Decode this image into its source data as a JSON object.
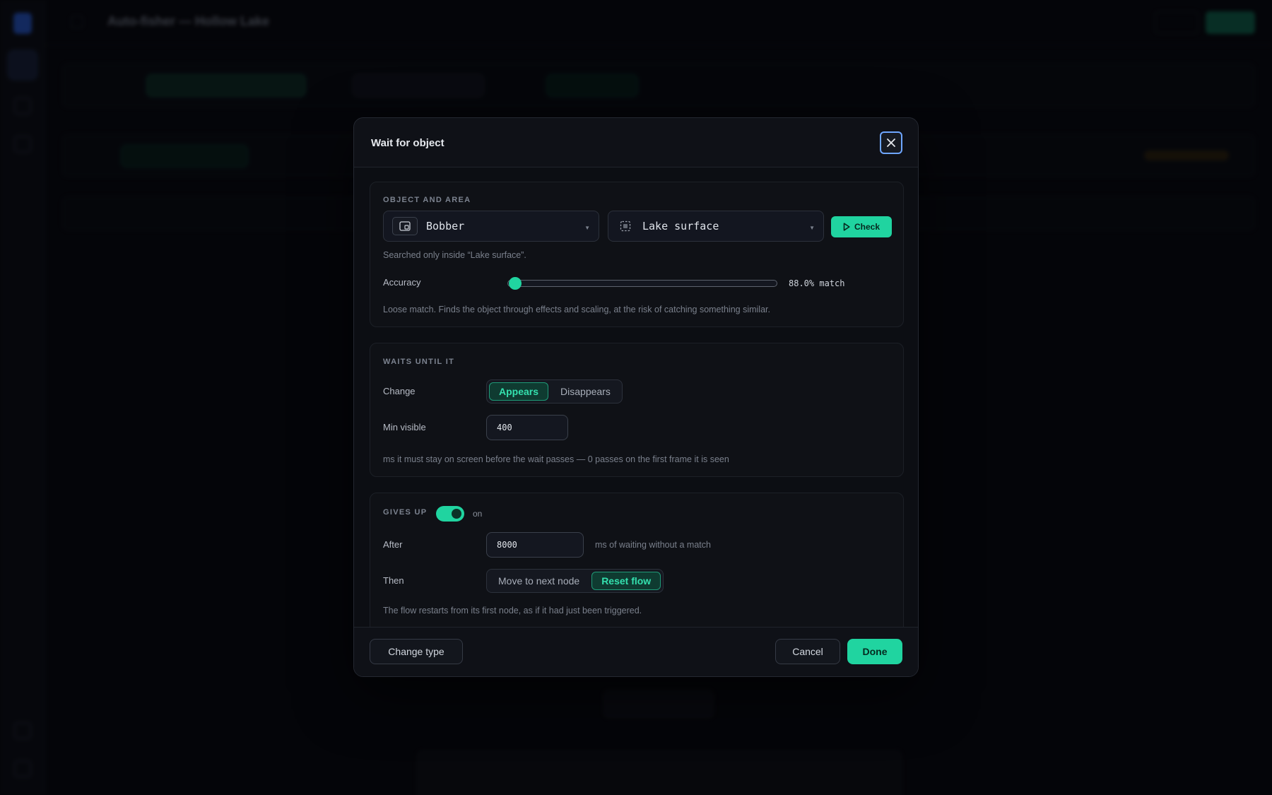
{
  "app": {
    "title": "Auto-fisher — Hollow Lake"
  },
  "modal": {
    "title": "Wait for object",
    "object_area": {
      "section_label": "OBJECT AND AREA",
      "object_select": {
        "value": "Bobber",
        "icon": "image-icon"
      },
      "area_select": {
        "value": "Lake surface",
        "icon": "region-icon"
      },
      "check_button": "Check",
      "search_note": "Searched only inside “Lake surface”.",
      "accuracy_label": "Accuracy",
      "accuracy_fraction": 0.0,
      "accuracy_value": "88.0% match",
      "accuracy_hint": "Loose match. Finds the object through effects and scaling, at the risk of catching something similar."
    },
    "waits_until": {
      "section_label": "WAITS UNTIL IT",
      "change_label": "Change",
      "change_options": [
        "Appears",
        "Disappears"
      ],
      "change_selected": "Appears",
      "min_visible_label": "Min visible",
      "min_visible_value": "400",
      "min_visible_hint": "ms it must stay on screen before the wait passes — 0 passes on the first frame it is seen"
    },
    "gives_up": {
      "section_label": "GIVES UP",
      "toggle_state": "on",
      "after_label": "After",
      "after_value": "8000",
      "after_suffix": "ms of waiting without a match",
      "then_label": "Then",
      "then_options": [
        "Move to next node",
        "Reset flow"
      ],
      "then_selected": "Reset flow",
      "then_hint": "The flow restarts from its first node, as if it had just been triggered."
    },
    "footer": {
      "change_type": "Change type",
      "cancel": "Cancel",
      "done": "Done"
    }
  },
  "colors": {
    "accent": "#20d4a0",
    "focus_ring": "#6ea6ff",
    "panel": "#0f1117"
  }
}
